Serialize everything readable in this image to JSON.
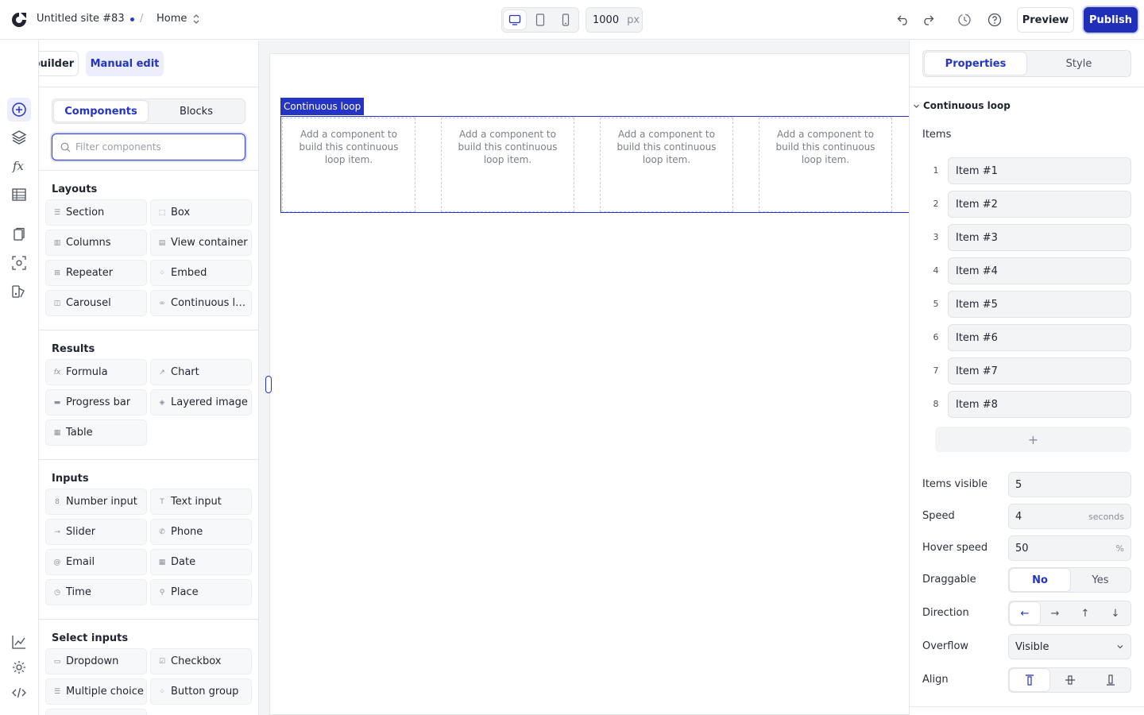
{
  "topbar": {
    "site_name": "Untitled site #83",
    "page": "Home",
    "canvas_width": "1000",
    "canvas_unit": "px",
    "preview_label": "Preview",
    "publish_label": "Publish"
  },
  "mode": {
    "ai_label": "AI builder",
    "manual_label": "Manual edit"
  },
  "left_tabs": {
    "components": "Components",
    "blocks": "Blocks"
  },
  "filter": {
    "placeholder": "Filter components"
  },
  "sections": {
    "layouts": {
      "title": "Layouts",
      "items": [
        "Section",
        "Box",
        "Columns",
        "View container",
        "Repeater",
        "Embed",
        "Carousel",
        "Continuous loop"
      ]
    },
    "results": {
      "title": "Results",
      "items": [
        "Formula",
        "Chart",
        "Progress bar",
        "Layered image",
        "Table"
      ]
    },
    "inputs": {
      "title": "Inputs",
      "items": [
        "Number input",
        "Text input",
        "Slider",
        "Phone",
        "Email",
        "Date",
        "Time",
        "Place"
      ]
    },
    "select_inputs": {
      "title": "Select inputs",
      "items": [
        "Dropdown",
        "Checkbox",
        "Multiple choice",
        "Button group"
      ]
    }
  },
  "canvas": {
    "loop_tag": "Continuous loop",
    "placeholder": "Add a component to build this continuous loop item."
  },
  "right_tabs": {
    "properties": "Properties",
    "style": "Style"
  },
  "props": {
    "section_title": "Continuous loop",
    "items_label": "Items",
    "items": [
      {
        "num": "1",
        "value": "Item #1"
      },
      {
        "num": "2",
        "value": "Item #2"
      },
      {
        "num": "3",
        "value": "Item #3"
      },
      {
        "num": "4",
        "value": "Item #4"
      },
      {
        "num": "5",
        "value": "Item #5"
      },
      {
        "num": "6",
        "value": "Item #6"
      },
      {
        "num": "7",
        "value": "Item #7"
      },
      {
        "num": "8",
        "value": "Item #8"
      }
    ],
    "add_label": "+",
    "items_visible": {
      "label": "Items visible",
      "value": "5"
    },
    "speed": {
      "label": "Speed",
      "value": "4",
      "unit": "seconds"
    },
    "hover_speed": {
      "label": "Hover speed",
      "value": "50",
      "unit": "%"
    },
    "draggable": {
      "label": "Draggable",
      "no": "No",
      "yes": "Yes"
    },
    "direction": {
      "label": "Direction",
      "arrows": [
        "←",
        "→",
        "↑",
        "↓"
      ]
    },
    "overflow": {
      "label": "Overflow",
      "value": "Visible"
    },
    "align": {
      "label": "Align"
    }
  },
  "colors": {
    "accent": "#2434c4",
    "publish": "#1f2fb8"
  }
}
